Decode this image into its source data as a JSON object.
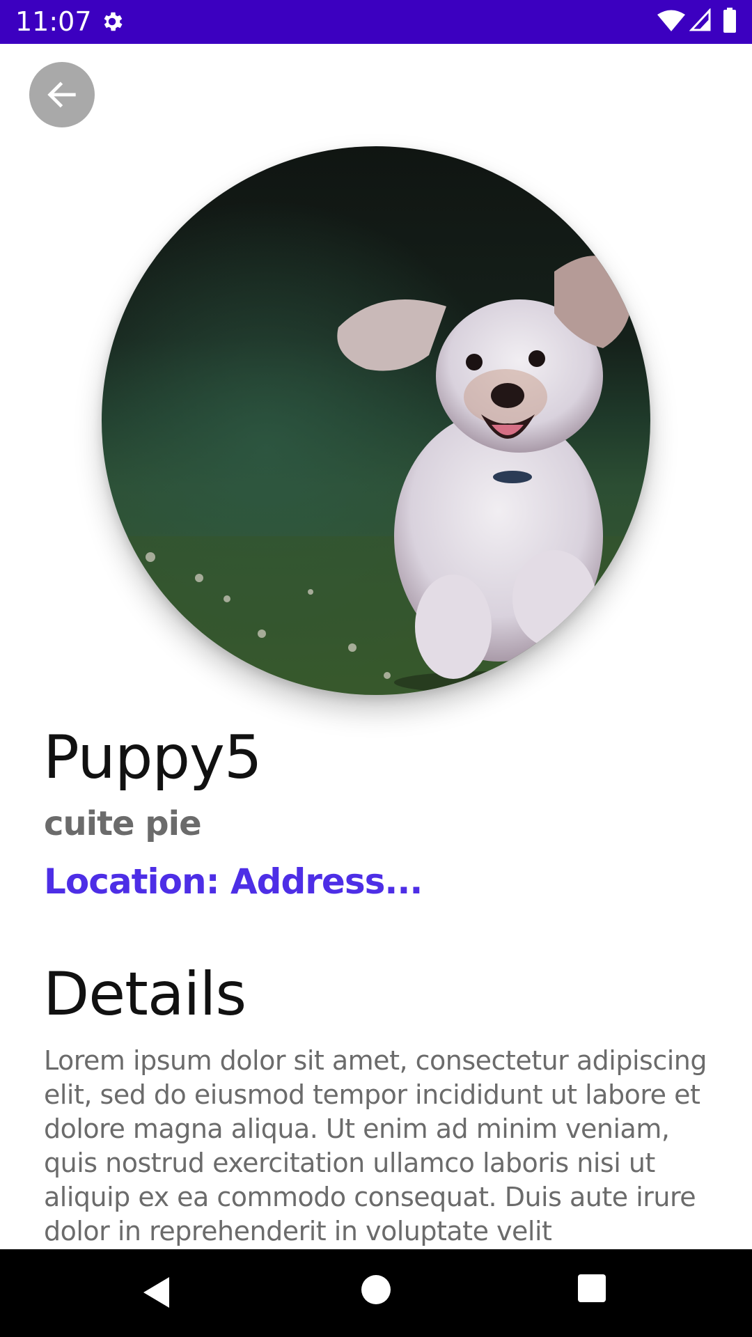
{
  "status_bar": {
    "time": "11:07",
    "background": "#3c00c0",
    "icons": [
      "gear-icon",
      "wifi-icon",
      "signal-icon",
      "battery-icon"
    ]
  },
  "header": {
    "back_icon": "arrow-left-icon"
  },
  "puppy": {
    "name": "Puppy5",
    "subtitle": "cuite pie",
    "location": "Location: Address...",
    "photo": "running-puppy-photo"
  },
  "details": {
    "heading": "Details",
    "body": "Lorem ipsum dolor sit amet, consectetur adipiscing elit, sed do eiusmod tempor incididunt ut labore et dolore magna aliqua. Ut enim ad minim veniam, quis nostrud exercitation ullamco laboris nisi ut aliquip ex ea commodo consequat. Duis aute irure dolor in reprehenderit in voluptate velit"
  },
  "colors": {
    "accent": "#4d2ee6",
    "secondary_text": "#6b6b6b"
  },
  "nav_bar": {
    "icons": [
      "nav-back-icon",
      "nav-home-icon",
      "nav-recents-icon"
    ]
  }
}
